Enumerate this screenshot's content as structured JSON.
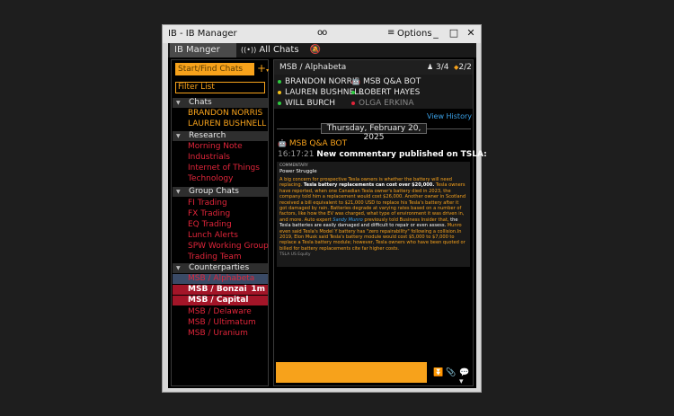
{
  "window": {
    "title": "IB - IB Manager",
    "options_label": "Options",
    "minimize": "_",
    "maximize": "□",
    "close": "✕"
  },
  "tabs": [
    {
      "label": "IB Manger"
    },
    {
      "label": "All Chats"
    }
  ],
  "left": {
    "search_placeholder": "Start/Find Chats",
    "plus": "+",
    "filter_placeholder": "Filter List",
    "sections": [
      {
        "label": "Chats",
        "items": [
          {
            "label": "BRANDON NORRIS"
          },
          {
            "label": "LAUREN BUSHNELL"
          }
        ]
      },
      {
        "label": "Research",
        "items": [
          {
            "label": "Morning Note"
          },
          {
            "label": "Industrials"
          },
          {
            "label": "Internet of Things"
          },
          {
            "label": "Technology"
          }
        ]
      },
      {
        "label": "Group Chats",
        "items": [
          {
            "label": "FI Trading"
          },
          {
            "label": "FX Trading"
          },
          {
            "label": "EQ Trading"
          },
          {
            "label": "Lunch Alerts"
          },
          {
            "label": "SPW Working Group"
          },
          {
            "label": "Trading Team"
          }
        ]
      },
      {
        "label": "Counterparties",
        "items": [
          {
            "label": "MSB / Alphabeta"
          },
          {
            "label": "MSB / Bonzai",
            "time": "1m"
          },
          {
            "label": "MSB / Capital"
          },
          {
            "label": "MSB / Delaware"
          },
          {
            "label": "MSB / Ultimatum"
          },
          {
            "label": "MSB / Uranium"
          }
        ]
      }
    ]
  },
  "chat": {
    "title": "MSB / Alphabeta",
    "count1": "3/4",
    "count2": "2/2",
    "members": [
      {
        "name": "BRANDON NORRIS",
        "color": "#2ecc40"
      },
      {
        "name": "MSB Q&A BOT",
        "color": "#f7a21b"
      },
      {
        "name": "LAUREN BUSHNELL",
        "color": "#f7c21b"
      },
      {
        "name": "ROBERT HAYES",
        "color": "#2ecc40"
      },
      {
        "name": "WILL BURCH",
        "color": "#2ecc40"
      },
      {
        "name": "OLGA ERKINA",
        "color": "#e0253a"
      }
    ],
    "view_history": "View History",
    "date": "Thursday, February 20, 2025",
    "bot_name": "MSB Q&A BOT",
    "timestamp": "16:17:21",
    "message": "New commentary published on TSLA:",
    "card": {
      "category": "COMMENTARY",
      "headline": "Power Struggle",
      "ticker": "TSLA US Equity",
      "parts": [
        {
          "t": "A big concern for prospective Tesla owners is whether the battery will need replacing. "
        },
        {
          "t": "Tesla battery replacements can cost over $20,000.",
          "s": "b"
        },
        {
          "t": " Tesla owners have reported, when one Canadian Tesla owner's battery died in 2023, the company told him a replacement would cost $26,000. Another owner in Scotland received a bill equivalent to $21,000 USD to replace his Tesla's battery after it got damaged by rain. Batteries degrade at varying rates based on a number of factors, like how the EV was charged, what type of environment it was driven in, and more. Auto expert "
        },
        {
          "t": "Sandy Munro",
          "s": "i"
        },
        {
          "t": " previously told Business Insider that, "
        },
        {
          "t": "the Tesla batteries are easily damaged and difficult to repair or even assess.",
          "s": "w"
        },
        {
          "t": " Munro even said Tesla's Model Y battery has \"zero repairability\" following a collision.In 2019, Elon Musk said Tesla's battery module would cost $5,000 to $7,000 to replace a Tesla battery module; however, Tesla owners who have been quoted or billed for battery replacements cite far higher costs."
        }
      ]
    }
  },
  "colors": {
    "accent": "#f7a21b",
    "red": "#e0253a",
    "link": "#3aa0e6"
  }
}
